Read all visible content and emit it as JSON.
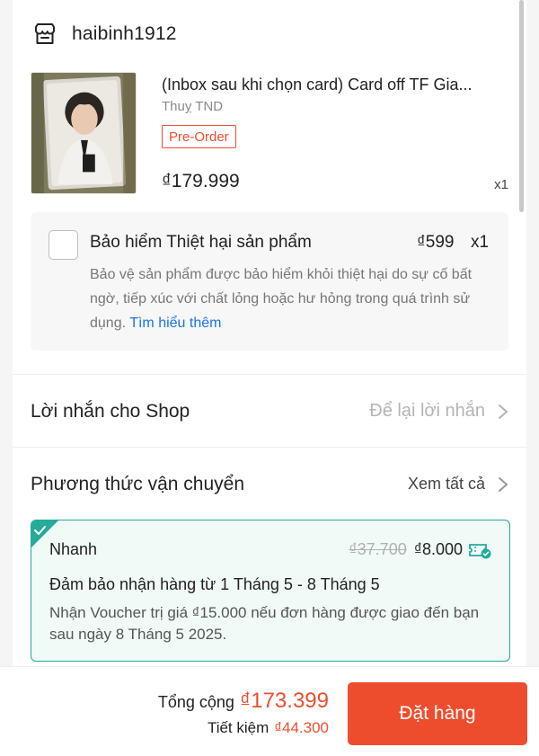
{
  "shop": {
    "name": "haibinh1912",
    "icon": "shop-icon"
  },
  "product": {
    "title": "(Inbox sau khi chọn card) Card off TF Gia...",
    "variant": "Thuỵ TND",
    "badge": "Pre-Order",
    "price": "₫179.999",
    "quantity": "x1"
  },
  "insurance": {
    "title": "Bảo hiểm Thiệt hại sản phẩm",
    "price": "₫599",
    "quantity": "x1",
    "description": "Bảo vệ sản phẩm được bảo hiểm khỏi thiệt hại do sự cố bất ngờ, tiếp xúc với chất lỏng hoặc hư hỏng trong quá trình sử dụng.",
    "link": "Tìm hiểu thêm",
    "checked": false
  },
  "message": {
    "label": "Lời nhắn cho Shop",
    "placeholder": "Để lại lời nhắn"
  },
  "shipping": {
    "label": "Phương thức vận chuyển",
    "see_all": "Xem tất cả",
    "option": {
      "name": "Nhanh",
      "old_price": "₫37.700",
      "new_price": "₫8.000",
      "guarantee": "Đảm bảo nhận hàng từ 1 Tháng 5 - 8 Tháng 5",
      "note": "Nhận Voucher trị giá ₫15.000 nếu đơn hàng được giao đến bạn sau ngày 8 Tháng 5 2025."
    }
  },
  "footer": {
    "total_label": "Tổng cộng",
    "total_value": "₫173.399",
    "savings_label": "Tiết kiệm",
    "savings_value": "₫44.300",
    "order_button": "Đặt hàng"
  },
  "colors": {
    "accent": "#ee4d2d",
    "teal": "#26aa99",
    "link": "#1a73e8"
  }
}
